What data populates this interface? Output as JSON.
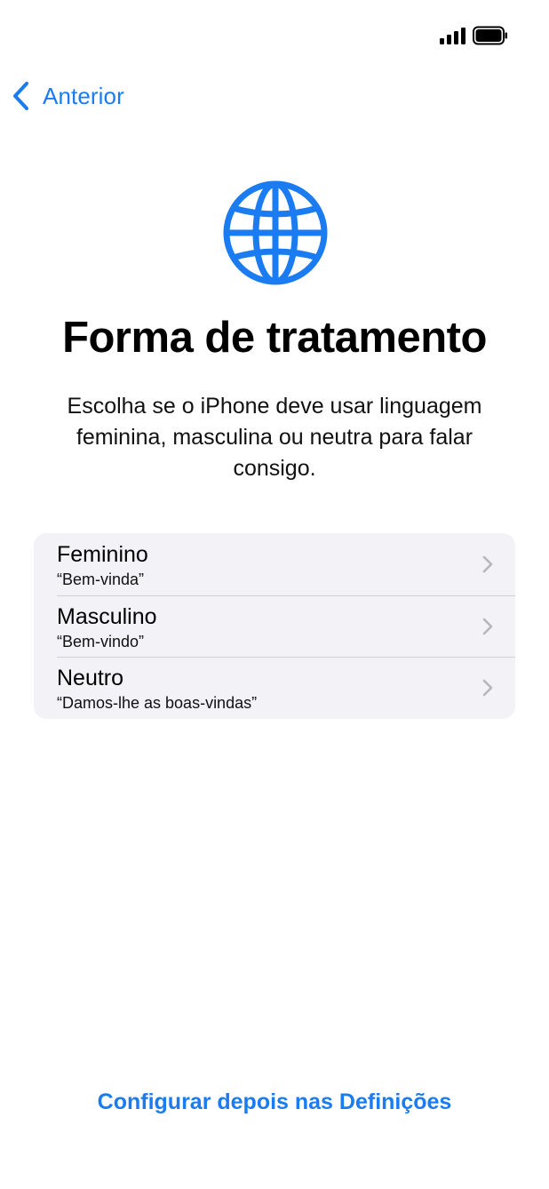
{
  "colors": {
    "accent": "#1a7cf0",
    "group_background": "#f2f2f7",
    "chevron_gray": "#b6b6bb"
  },
  "status_bar": {
    "signal_icon": "cellular-signal-icon",
    "battery_icon": "battery-icon"
  },
  "nav": {
    "back_icon": "chevron-left-icon",
    "back_label": "Anterior"
  },
  "header": {
    "icon": "globe-icon",
    "title": "Forma de tratamento",
    "subtitle": "Escolha se o iPhone deve usar linguagem feminina, masculina ou neutra para falar consigo."
  },
  "options": [
    {
      "title": "Feminino",
      "subtitle": "“Bem-vinda”",
      "icon": "chevron-right-icon"
    },
    {
      "title": "Masculino",
      "subtitle": "“Bem-vindo”",
      "icon": "chevron-right-icon"
    },
    {
      "title": "Neutro",
      "subtitle": "“Damos-lhe as boas-vindas”",
      "icon": "chevron-right-icon"
    }
  ],
  "footer": {
    "link_label": "Configurar depois nas Definições"
  }
}
